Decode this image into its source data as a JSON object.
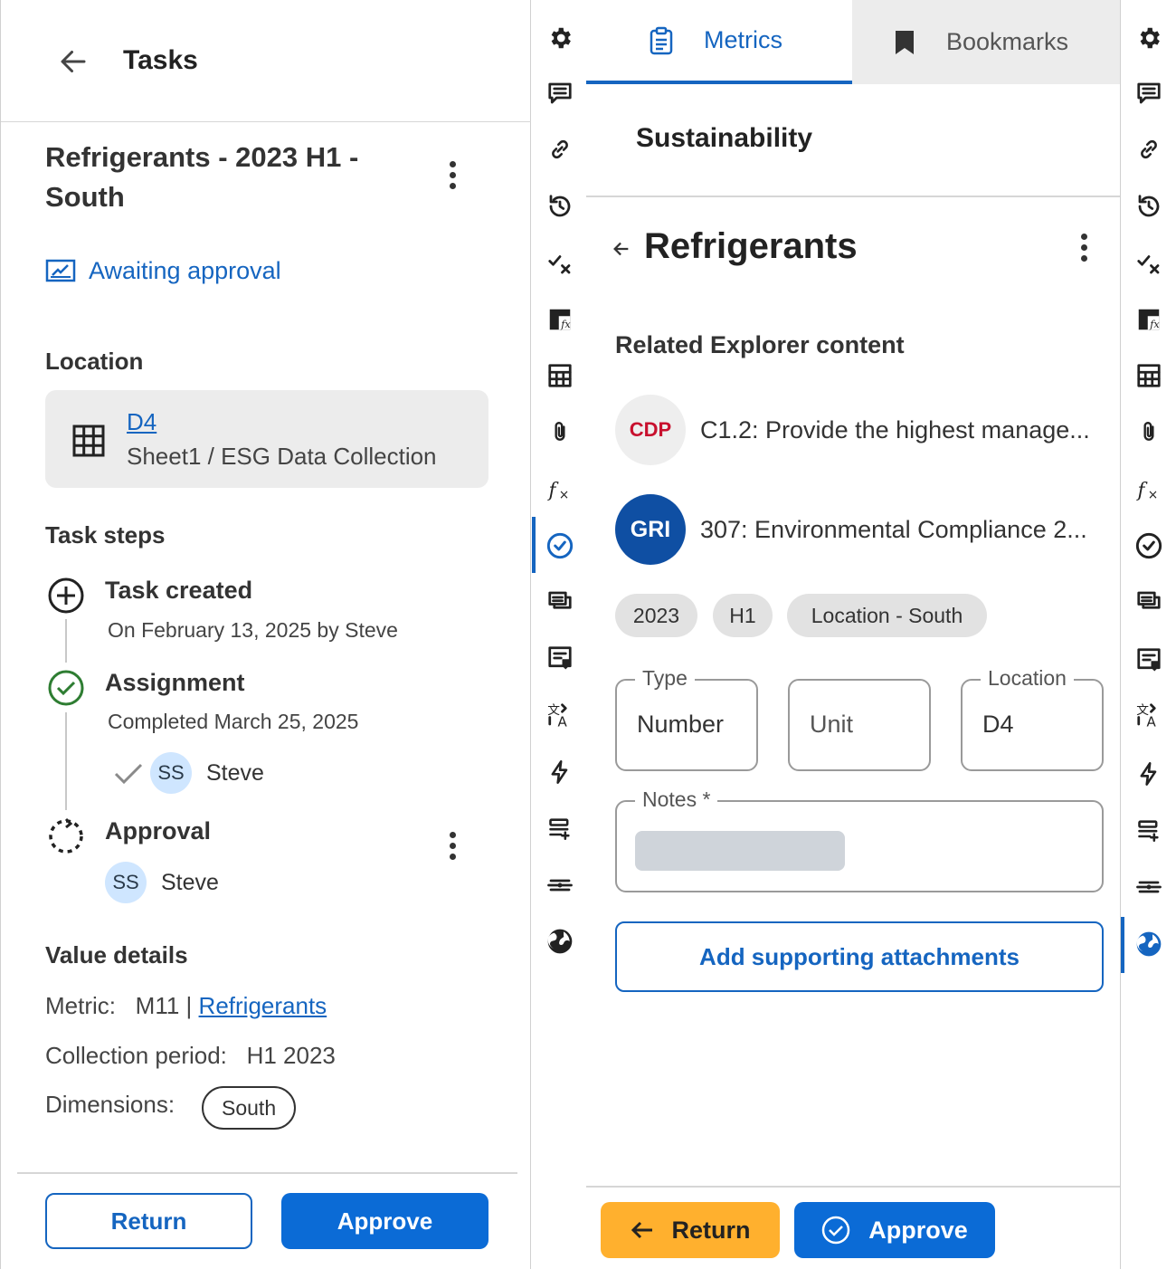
{
  "left_panel": {
    "title": "Tasks",
    "task_title": "Refrigerants - 2023 H1 - South",
    "status": "Awaiting approval",
    "location": {
      "heading": "Location",
      "cell": "D4",
      "path": "Sheet1 / ESG Data Collection"
    },
    "task_steps": {
      "heading": "Task steps",
      "created_title": "Task created",
      "created_sub": "On February 13, 2025 by Steve",
      "assignment_title": "Assignment",
      "assignment_sub": "Completed March 25, 2025",
      "assignee_initials": "SS",
      "assignee_name": "Steve",
      "approval_title": "Approval",
      "approver_initials": "SS",
      "approver_name": "Steve"
    },
    "value_details": {
      "heading": "Value details",
      "metric_label": "Metric:",
      "metric_code": "M11 |",
      "metric_link": "Refrigerants",
      "period_label": "Collection period:",
      "period_value": "H1 2023",
      "dimensions_label": "Dimensions:",
      "dimension_chip": "South"
    },
    "buttons": {
      "return": "Return",
      "approve": "Approve"
    }
  },
  "right_panel": {
    "tabs": {
      "metrics": "Metrics",
      "bookmarks": "Bookmarks"
    },
    "section": "Sustainability",
    "title": "Refrigerants",
    "related_heading": "Related Explorer content",
    "related": [
      {
        "logo": "CDP",
        "text": "C1.2: Provide the highest manage..."
      },
      {
        "logo": "GRI",
        "text": "307: Environmental Compliance 2..."
      }
    ],
    "tags": [
      "2023",
      "H1",
      "Location - South"
    ],
    "fields": {
      "type_label": "Type",
      "type_value": "Number",
      "unit_placeholder": "Unit",
      "location_label": "Location",
      "location_value": "D4",
      "notes_label": "Notes *"
    },
    "add_attachments": "Add supporting attachments",
    "buttons": {
      "return": "Return",
      "approve": "Approve"
    }
  },
  "rail_icons": [
    "gear-icon",
    "comment-icon",
    "link-icon",
    "history-icon",
    "check-x-icon",
    "sheet-formula-icon",
    "table-icon",
    "paperclip-icon",
    "function-icon",
    "check-circle-icon",
    "list-comment-icon",
    "note-icon",
    "translate-icon",
    "lightning-icon",
    "rows-add-icon",
    "split-icon",
    "globe-icon"
  ],
  "colors": {
    "accent": "#1565c0",
    "primary_button": "#0b6bd6",
    "return_button": "#ffb02e",
    "success": "#2e7d32"
  }
}
